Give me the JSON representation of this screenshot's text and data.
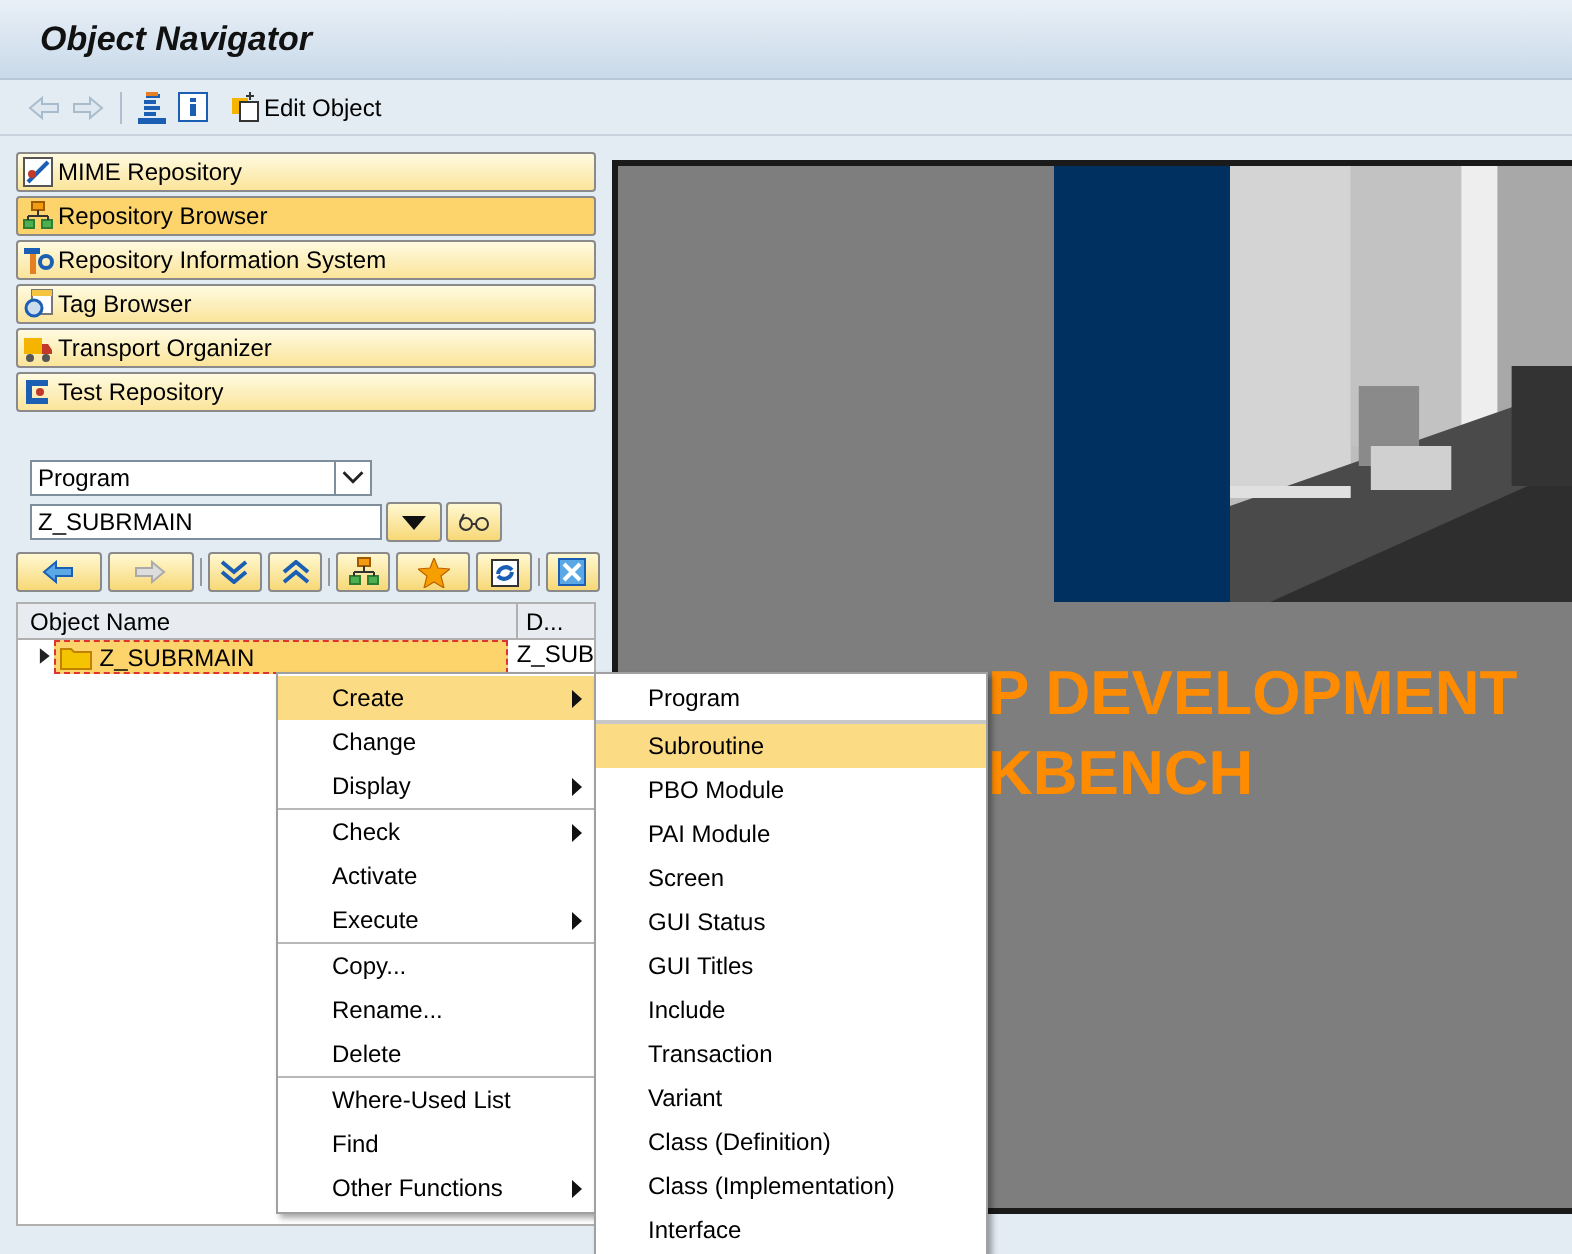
{
  "window": {
    "title": "Object Navigator"
  },
  "toolbar": {
    "edit_button": "Edit Object"
  },
  "nav_buttons": [
    {
      "label": "MIME Repository",
      "selected": false
    },
    {
      "label": "Repository Browser",
      "selected": true
    },
    {
      "label": "Repository Information System",
      "selected": false
    },
    {
      "label": "Tag Browser",
      "selected": false
    },
    {
      "label": "Transport Organizer",
      "selected": false
    },
    {
      "label": "Test Repository",
      "selected": false
    }
  ],
  "object_type": {
    "value": "Program"
  },
  "object_name": {
    "value": "Z_SUBRMAIN"
  },
  "tree": {
    "columns": [
      "Object Name",
      "D..."
    ],
    "rows": [
      {
        "name": "Z_SUBRMAIN",
        "column_2": "Z_SUB",
        "selected": true,
        "expanded": false
      }
    ]
  },
  "banner": {
    "lines": [
      "P DEVELOPMENT",
      "KBENCH"
    ]
  },
  "context_menu": {
    "groups": [
      [
        {
          "label": "Create",
          "submenu": true,
          "selected": true
        },
        {
          "label": "Change",
          "submenu": false,
          "selected": false
        },
        {
          "label": "Display",
          "submenu": true,
          "selected": false
        }
      ],
      [
        {
          "label": "Check",
          "submenu": true,
          "selected": false
        },
        {
          "label": "Activate",
          "submenu": false,
          "selected": false
        },
        {
          "label": "Execute",
          "submenu": true,
          "selected": false
        }
      ],
      [
        {
          "label": "Copy...",
          "submenu": false,
          "selected": false
        },
        {
          "label": "Rename...",
          "submenu": false,
          "selected": false
        },
        {
          "label": "Delete",
          "submenu": false,
          "selected": false
        }
      ],
      [
        {
          "label": "Where-Used List",
          "submenu": false,
          "selected": false
        },
        {
          "label": "Find",
          "submenu": false,
          "selected": false
        },
        {
          "label": "Other Functions",
          "submenu": true,
          "selected": false
        }
      ]
    ]
  },
  "submenu": {
    "groups": [
      [
        {
          "label": "Program",
          "selected": false
        }
      ],
      [
        {
          "label": "Subroutine",
          "selected": true
        },
        {
          "label": "PBO Module",
          "selected": false
        },
        {
          "label": "PAI Module",
          "selected": false
        },
        {
          "label": "Screen",
          "selected": false
        },
        {
          "label": "GUI Status",
          "selected": false
        },
        {
          "label": "GUI Titles",
          "selected": false
        },
        {
          "label": "Include",
          "selected": false
        },
        {
          "label": "Transaction",
          "selected": false
        },
        {
          "label": "Variant",
          "selected": false
        },
        {
          "label": "Class (Definition)",
          "selected": false
        },
        {
          "label": "Class (Implementation)",
          "selected": false
        },
        {
          "label": "Interface",
          "selected": false
        }
      ]
    ]
  }
}
